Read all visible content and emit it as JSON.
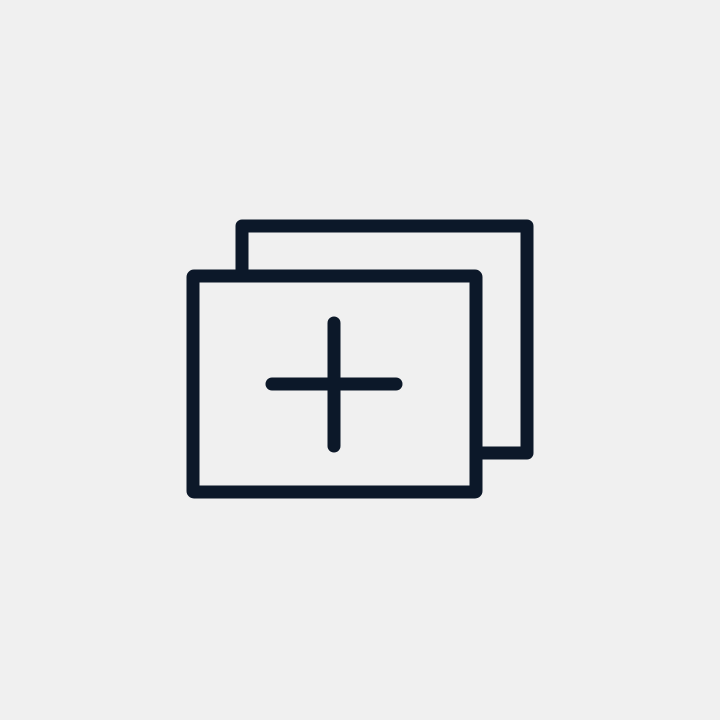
{
  "icon": {
    "name": "add-layers-icon",
    "parts": [
      "back-card",
      "front-card",
      "plus-sign"
    ]
  },
  "colors": {
    "background": "#f0f0f0",
    "stroke": "#0c1829"
  }
}
